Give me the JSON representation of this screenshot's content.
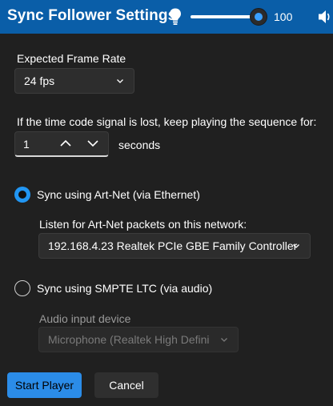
{
  "titlebar": {
    "title": "Sync Follower Settings",
    "bulb_icon": "lightbulb-icon",
    "volume_value": "100",
    "volume_level": 1.0,
    "speaker_icon": "speaker-icon",
    "accent": "#0a5ea8"
  },
  "frame_rate": {
    "label": "Expected Frame Rate",
    "value": "24 fps"
  },
  "timecode": {
    "label": "If the time code signal is lost, keep playing the sequence for:",
    "value": "1",
    "unit": "seconds"
  },
  "artnet": {
    "radio_label": "Sync using Art-Net  (via Ethernet)",
    "selected": true,
    "network_label": "Listen for Art-Net packets on this network:",
    "network_value": "192.168.4.23  Realtek PCIe GBE Family Controller"
  },
  "smpte": {
    "radio_label": "Sync using SMPTE LTC (via audio)",
    "selected": false,
    "device_label": "Audio input device",
    "device_value": "Microphone (Realtek High Defini"
  },
  "buttons": {
    "start": "Start Player",
    "cancel": "Cancel"
  },
  "colors": {
    "primary_button": "#2b8ce8",
    "radio_accent": "#2196f3",
    "background": "#202020"
  }
}
